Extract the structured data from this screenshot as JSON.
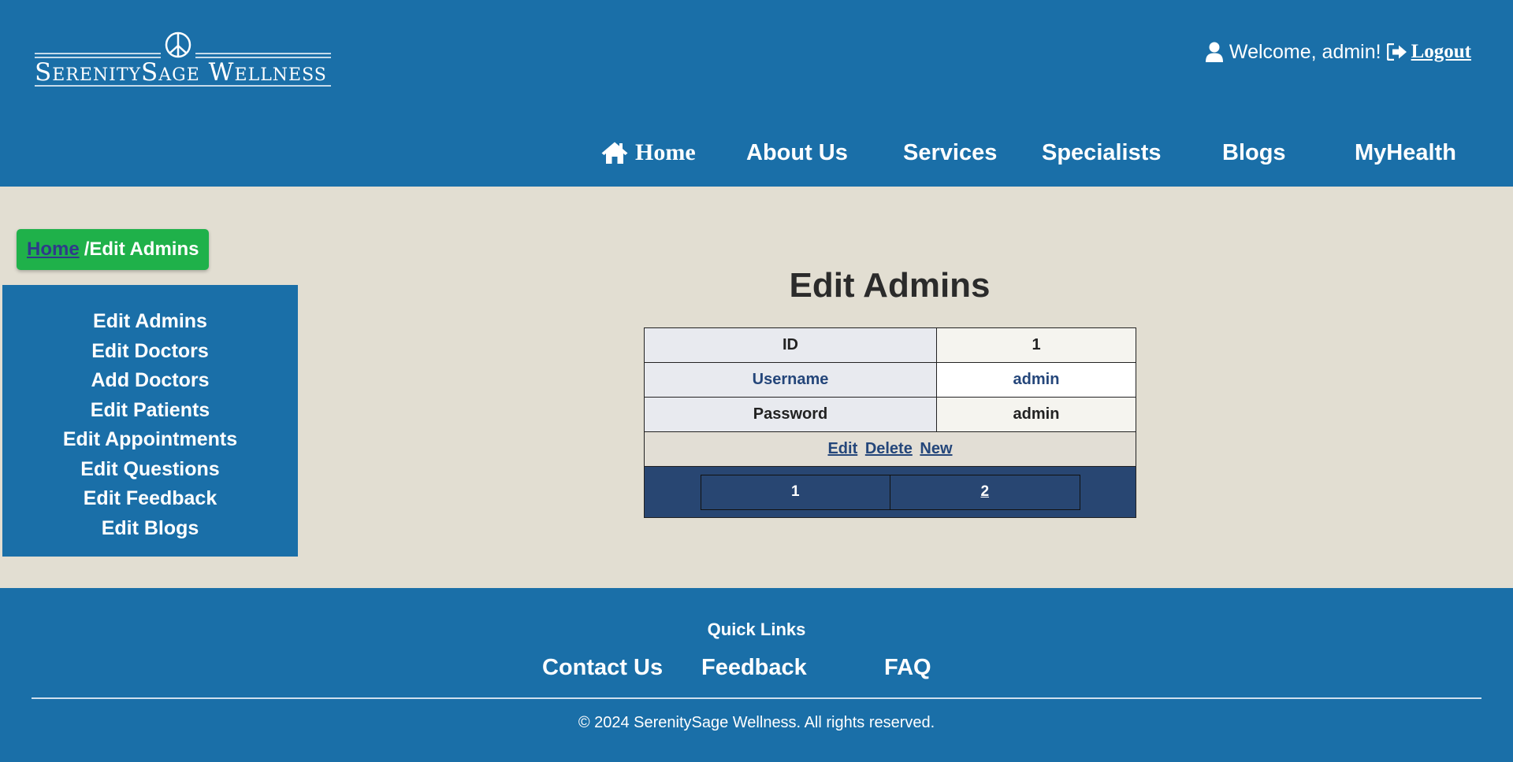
{
  "header": {
    "logo_text": "SerenitySage Wellness",
    "welcome_text": "Welcome, admin!",
    "logout_label": "Logout"
  },
  "nav": {
    "home": "Home",
    "about": "About Us",
    "services": "Services",
    "specialists": "Specialists",
    "blogs": "Blogs",
    "myhealth": "MyHealth"
  },
  "breadcrumb": {
    "home": "Home",
    "current": "/Edit Admins"
  },
  "sidebar": {
    "items": [
      "Edit Admins",
      "Edit Doctors",
      "Add Doctors",
      "Edit Patients",
      "Edit Appointments",
      "Edit Questions",
      "Edit Feedback",
      "Edit Blogs"
    ]
  },
  "main": {
    "title": "Edit Admins",
    "rows": [
      {
        "key": "ID",
        "value": "1"
      },
      {
        "key": "Username",
        "value": "admin"
      },
      {
        "key": "Password",
        "value": "admin"
      }
    ],
    "actions": {
      "edit": "Edit",
      "delete": "Delete",
      "new": "New"
    },
    "pagination": {
      "pages": [
        "1",
        "2"
      ],
      "current": "1"
    }
  },
  "footer": {
    "heading": "Quick Links",
    "links": {
      "contact": "Contact Us",
      "feedback": "Feedback",
      "faq": "FAQ"
    },
    "copyright": "© 2024 SerenitySage Wellness. All rights reserved."
  },
  "colors": {
    "brand_blue": "#1a6fa8",
    "page_background": "#e2ded2",
    "breadcrumb_green": "#1fb14a",
    "table_navy": "#284672"
  },
  "icons": {
    "logo": "peace-sign-icon",
    "welcome": "user-icon",
    "logout": "sign-out-icon",
    "home": "home-icon"
  }
}
